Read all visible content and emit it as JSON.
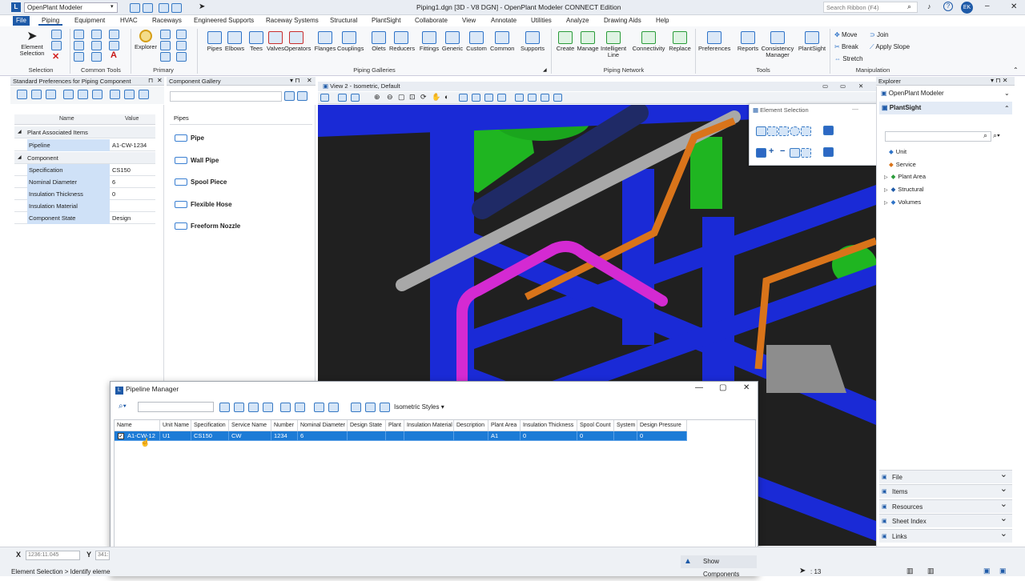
{
  "titlebar": {
    "app_dropdown": "OpenPlant Modeler",
    "title": "Piping1.dgn [3D - V8 DGN] - OpenPlant Modeler CONNECT Edition",
    "search_placeholder": "Search Ribbon (F4)",
    "user_initials": "EK"
  },
  "menu": [
    "File",
    "Piping",
    "Equipment",
    "HVAC",
    "Raceways",
    "Engineered Supports",
    "Raceway Systems",
    "Structural",
    "PlantSight",
    "Collaborate",
    "View",
    "Annotate",
    "Utilities",
    "Analyze",
    "Drawing Aids",
    "Help"
  ],
  "ribbon": {
    "selection": {
      "label": "Selection",
      "element_selection": "Element Selection"
    },
    "common_tools": {
      "label": "Common Tools"
    },
    "primary": {
      "label": "Primary",
      "explorer": "Explorer"
    },
    "galleries": {
      "label": "Piping Galleries",
      "items": [
        "Pipes",
        "Elbows",
        "Tees",
        "Valves",
        "Operators",
        "Flanges",
        "Couplings",
        "Olets",
        "Reducers",
        "Fittings",
        "Generic",
        "Custom",
        "Common",
        "Supports"
      ]
    },
    "network": {
      "label": "Piping Network",
      "items": [
        "Create",
        "Manage",
        "Intelligent Line",
        "Connectivity",
        "Replace"
      ]
    },
    "tools": {
      "label": "Tools",
      "items": [
        "Preferences",
        "Reports",
        "Consistency Manager",
        "PlantSight"
      ]
    },
    "manipulation": {
      "label": "Manipulation",
      "items": [
        "Move",
        "Join",
        "Break",
        "Apply Slope",
        "Stretch"
      ]
    }
  },
  "prefs": {
    "title": "Standard Preferences for Piping Component",
    "col_name": "Name",
    "col_value": "Value",
    "group1": "Plant Associated Items",
    "rows1": [
      {
        "k": "Pipeline",
        "v": "A1-CW-1234"
      }
    ],
    "group2": "Component",
    "rows2": [
      {
        "k": "Specification",
        "v": "CS150"
      },
      {
        "k": "Nominal Diameter",
        "v": "6"
      },
      {
        "k": "Insulation Thickness",
        "v": "0"
      },
      {
        "k": "Insulation Material",
        "v": ""
      },
      {
        "k": "Component State",
        "v": "Design"
      }
    ]
  },
  "gallery": {
    "title": "Component Gallery",
    "section": "Pipes",
    "items": [
      "Pipe",
      "Wall Pipe",
      "Spool Piece",
      "Flexible Hose",
      "Freeform Nozzle"
    ]
  },
  "view": {
    "title": "View 2 - Isometric, Default"
  },
  "element_selection": {
    "title": "Element Selection"
  },
  "explorer": {
    "title": "Explorer",
    "root": "OpenPlant Modeler",
    "section": "PlantSight",
    "tree": [
      "Unit",
      "Service",
      "Plant Area",
      "Structural",
      "Volumes"
    ],
    "accordions": [
      "File",
      "Items",
      "Resources",
      "Sheet Index",
      "Links"
    ]
  },
  "pipeline_manager": {
    "title": "Pipeline Manager",
    "iso_styles": "Isometric Styles",
    "columns": [
      "Name",
      "Unit Name",
      "Specification",
      "Service Name",
      "Number",
      "Nominal Diameter",
      "Design State",
      "Plant",
      "Insulation Material",
      "Description",
      "Plant Area",
      "Insulation Thickness",
      "Spool Count",
      "System",
      "Design Pressure"
    ],
    "rows": [
      [
        "A1-CW-12",
        "U1",
        "CS150",
        "CW",
        "1234",
        "6",
        "",
        "",
        "",
        "",
        "A1",
        "0",
        "0",
        "",
        "0"
      ]
    ],
    "show_components": "Show Components"
  },
  "status": {
    "x_label": "X",
    "x_value": "1236:11.045",
    "y_label": "Y",
    "y_value": "341:",
    "prompt": "Element Selection > Identify element",
    "count": ": 13"
  },
  "colors": {
    "accent": "#1e5aa8",
    "steel": "#1a2ad6",
    "pipe_magenta": "#d42ad2",
    "pipe_orange": "#d9741a",
    "equipment_green": "#1fb521"
  }
}
